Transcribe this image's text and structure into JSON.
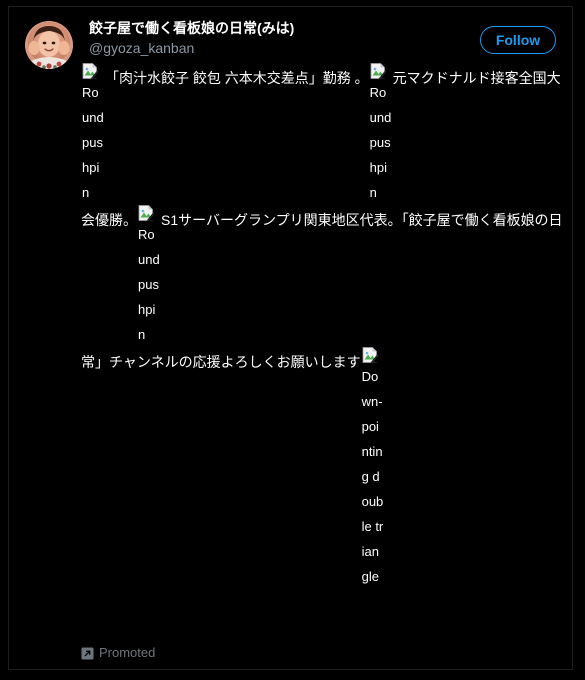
{
  "card": {
    "profile": {
      "display_name": "餃子屋で働く看板娘の日常(みは)",
      "handle": "@gyoza_kanban",
      "avatar_alt": "profile photo",
      "follow_label": "Follow"
    },
    "bio": {
      "segment_1": "「肉汁水餃子 餃包 六本木交差点」勤務 。",
      "segment_2": "元マクドナルド接客全国大会優勝。",
      "segment_3": "S1サーバーグランプリ関東地区代表。「餃子屋で働く看板娘の日常」チャンネルの応援よろしくお願いします",
      "broken_images": [
        {
          "alt": "Round pushpin"
        },
        {
          "alt": "Round pushpin"
        },
        {
          "alt": "Round pushpin"
        },
        {
          "alt": "Down-pointing double triangle"
        }
      ]
    },
    "footer": {
      "promoted_label": "Promoted",
      "promoted_icon": "external-link-icon"
    },
    "colors": {
      "background": "#000000",
      "border": "#1d1f22",
      "accent": "#1d9bf0",
      "muted_text": "#8b98a5",
      "footer_text": "#6e767d"
    }
  }
}
